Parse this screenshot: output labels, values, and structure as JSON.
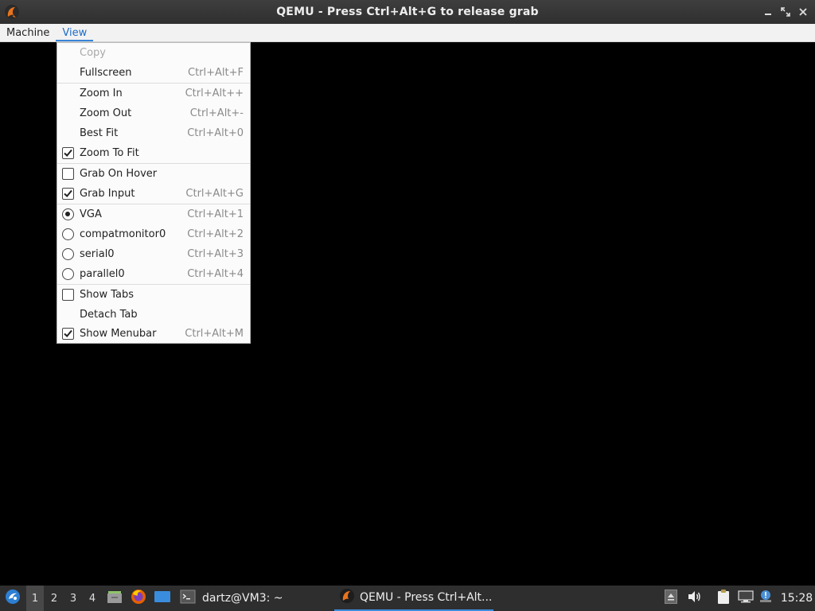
{
  "window": {
    "title": "QEMU - Press Ctrl+Alt+G to release grab",
    "icon": "qemu-icon",
    "controls": [
      "minimize",
      "maximize",
      "close"
    ]
  },
  "menubar": {
    "items": [
      {
        "label": "Machine"
      },
      {
        "label": "View"
      }
    ]
  },
  "view_menu": {
    "items": [
      {
        "label": "Copy",
        "shortcut": "",
        "indicator": "none",
        "enabled": false
      },
      {
        "label": "Fullscreen",
        "shortcut": "Ctrl+Alt+F",
        "indicator": "none",
        "enabled": true
      },
      {
        "label": "Zoom In",
        "shortcut": "Ctrl+Alt++",
        "indicator": "none",
        "enabled": true
      },
      {
        "label": "Zoom Out",
        "shortcut": "Ctrl+Alt+-",
        "indicator": "none",
        "enabled": true
      },
      {
        "label": "Best Fit",
        "shortcut": "Ctrl+Alt+0",
        "indicator": "none",
        "enabled": true
      },
      {
        "label": "Zoom To Fit",
        "shortcut": "",
        "indicator": "checkbox",
        "checked": true
      },
      {
        "label": "Grab On Hover",
        "shortcut": "",
        "indicator": "checkbox",
        "checked": false
      },
      {
        "label": "Grab Input",
        "shortcut": "Ctrl+Alt+G",
        "indicator": "checkbox",
        "checked": true
      },
      {
        "label": "VGA",
        "shortcut": "Ctrl+Alt+1",
        "indicator": "radio",
        "checked": true
      },
      {
        "label": "compatmonitor0",
        "shortcut": "Ctrl+Alt+2",
        "indicator": "radio",
        "checked": false
      },
      {
        "label": "serial0",
        "shortcut": "Ctrl+Alt+3",
        "indicator": "radio",
        "checked": false
      },
      {
        "label": "parallel0",
        "shortcut": "Ctrl+Alt+4",
        "indicator": "radio",
        "checked": false
      },
      {
        "label": "Show Tabs",
        "shortcut": "",
        "indicator": "checkbox",
        "checked": false
      },
      {
        "label": "Detach Tab",
        "shortcut": "",
        "indicator": "none",
        "enabled": true
      },
      {
        "label": "Show Menubar",
        "shortcut": "Ctrl+Alt+M",
        "indicator": "checkbox",
        "checked": true
      }
    ]
  },
  "taskbar": {
    "workspaces": [
      "1",
      "2",
      "3",
      "4"
    ],
    "active_workspace": "1",
    "launchers": [
      "file-manager-icon",
      "firefox-icon",
      "desktop-icon"
    ],
    "tasks": [
      {
        "label": "dartz@VM3: ~",
        "icon": "terminal-icon"
      },
      {
        "label": "QEMU - Press Ctrl+Alt...",
        "icon": "qemu-icon"
      }
    ],
    "tray": [
      "eject-icon",
      "volume-icon",
      "clipboard-icon",
      "network-icon",
      "update-icon"
    ],
    "clock": "15:28"
  },
  "colors": {
    "accent": "#3884d8",
    "titlebar": "#3a3a3a",
    "taskbar": "#2e2e2e",
    "menu_bg": "#fbfbfb"
  }
}
